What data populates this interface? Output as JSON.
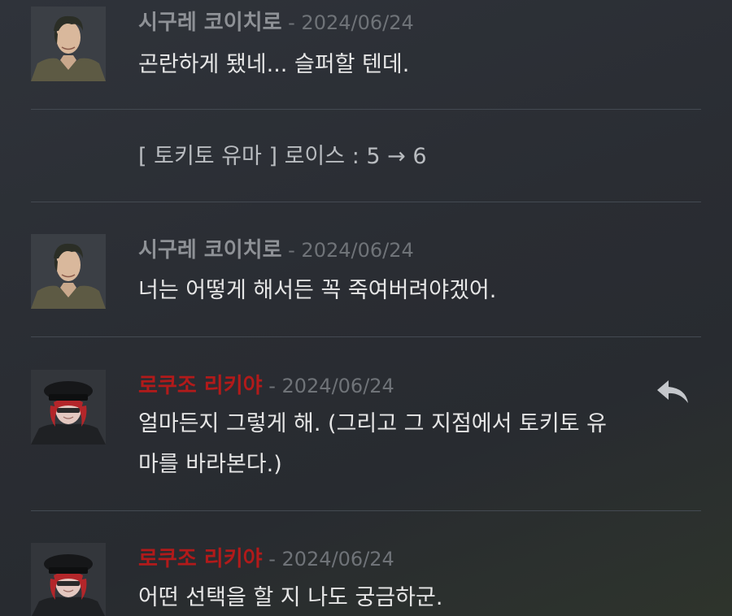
{
  "messages": [
    {
      "speaker": "시구레 코이치로",
      "separator": " - ",
      "date": "2024/06/24",
      "lines": [
        "곤란하게 됐네... 슬퍼할 텐데."
      ]
    },
    {
      "speaker": "시구레 코이치로",
      "separator": " - ",
      "date": "2024/06/24",
      "lines": [
        "너는 어떻게 해서든 꼭 죽여버려야겠어."
      ]
    },
    {
      "speaker": "로쿠조 리키야",
      "separator": " - ",
      "date": "2024/06/24",
      "lines": [
        "얼마든지 그렇게 해. (그리고 그 지점에서 토키토 유",
        "마를 바라본다.)"
      ],
      "reply_icon": "reply-arrow"
    },
    {
      "speaker": "로쿠조 리키야",
      "separator": " - ",
      "date": "2024/06/24",
      "lines": [
        "어떤 선택을 할 지 나도 궁금하군."
      ]
    }
  ],
  "system_message": "[ 토키토 유마 ] 로이스 : 5 → 6",
  "colors": {
    "background": "#2b2e34",
    "divider": "#444a52",
    "speaker_gray": "#8e9196",
    "speaker_red": "#b21a1a",
    "date": "#6f7378",
    "text": "#e6e6e6"
  },
  "icons": {
    "avatar_1": "man-portrait-icon",
    "avatar_2": "red-hair-officer-portrait-icon",
    "reply": "reply-arrow-icon"
  }
}
